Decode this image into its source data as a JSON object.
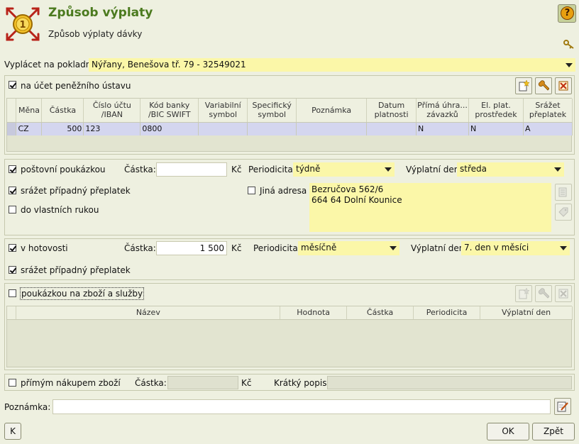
{
  "header": {
    "title": "Způsob výplaty",
    "subtitle": "Způsob výplaty dávky",
    "help": "?"
  },
  "pokladna": {
    "label": "Vyplácet na pokladnu:",
    "value": "Nýřany, Benešova tř. 79 - 32549021"
  },
  "ucet": {
    "label": "na účet peněžního ústavu",
    "checked": true,
    "columns": [
      "Měna",
      "Částka",
      "Číslo účtu /IBAN",
      "Kód banky /BIC SWIFT",
      "Variabilní symbol",
      "Specifický symbol",
      "Poznámka",
      "Datum platnosti",
      "Přímá úhra... závazků",
      "El. plat. prostředek",
      "Srážet přeplatek"
    ],
    "rows": [
      [
        "CZ",
        "500",
        "123",
        "0800",
        "",
        "",
        "",
        "",
        "N",
        "N",
        "A"
      ]
    ]
  },
  "postovni": {
    "label": "poštovní poukázkou",
    "checked": true,
    "castka_label": "Částka:",
    "castka_value": "",
    "currency": "Kč",
    "periodicita_label": "Periodicita:",
    "periodicita_value": "týdně",
    "den_label": "Výplatní den:",
    "den_value": "středa",
    "srazet_label": "srážet případný přeplatek",
    "srazet_checked": true,
    "rukou_label": "do vlastních rukou",
    "rukou_checked": false,
    "jina_label": "Jiná adresa",
    "jina_checked": false,
    "adresa_line1": "Bezručova 562/6",
    "adresa_line2": "664 64 Dolní Kounice"
  },
  "hotovost": {
    "label": "v hotovosti",
    "checked": true,
    "castka_label": "Částka:",
    "castka_value": "1 500",
    "currency": "Kč",
    "periodicita_label": "Periodicita:",
    "periodicita_value": "měsíčně",
    "den_label": "Výplatní den:",
    "den_value": "7. den v měsíci",
    "srazet_label": "srážet případný přeplatek",
    "srazet_checked": true
  },
  "poukazka": {
    "label": "poukázkou na zboží a služby",
    "checked": false,
    "columns": [
      "Název",
      "Hodnota",
      "Částka",
      "Periodicita",
      "Výplatní den"
    ]
  },
  "nakup": {
    "label": "přímým nákupem zboží",
    "checked": false,
    "castka_label": "Částka:",
    "currency": "Kč",
    "popis_label": "Krátký popis:"
  },
  "poznamka": {
    "label": "Poznámka:",
    "value": ""
  },
  "footer": {
    "k_label": "K",
    "ok_label": "OK",
    "back_label": "Zpět"
  },
  "colors": {
    "title": "#4b7a1e",
    "yellow_field": "#fbf7a8",
    "selected_row": "#d4d6ef",
    "background": "#eef0e0"
  }
}
